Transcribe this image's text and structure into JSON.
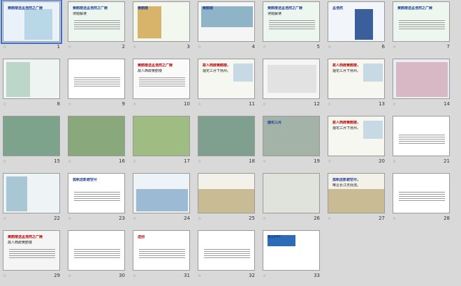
{
  "slides": [
    {
      "n": "1",
      "title": "黄鹤楼送孟浩然之广陵",
      "body": "",
      "bg": "#e8f2f8"
    },
    {
      "n": "2",
      "title": "黄鹤楼送孟浩然之广陵",
      "body": "诗题解读",
      "bg": "#eef7ef"
    },
    {
      "n": "3",
      "title": "黄鹤楼",
      "body": "",
      "bg": "#f3f8ee"
    },
    {
      "n": "4",
      "title": "黄鹤楼",
      "body": "",
      "bg": "#f5f5f5"
    },
    {
      "n": "5",
      "title": "黄鹤楼送孟浩然之广陵",
      "body": "诗题解读",
      "bg": "#eef7ef"
    },
    {
      "n": "6",
      "title": "孟浩然",
      "body": "",
      "bg": "#f2f6fb"
    },
    {
      "n": "7",
      "title": "黄鹤楼送孟浩然之广陵",
      "body": "",
      "bg": "#eef7ef"
    },
    {
      "n": "8",
      "title": "",
      "body": "",
      "bg": "#eef4f1"
    },
    {
      "n": "9",
      "title": "",
      "body": "",
      "bg": "#ffffff"
    },
    {
      "n": "10",
      "title": "黄鹤楼送孟浩然之广陵",
      "body": "故人西辞黄鹤楼",
      "bg": "#fafafa"
    },
    {
      "n": "11",
      "title": "故人西辞黄鹤楼，",
      "body": "烟花三月下扬州。",
      "bg": "#f7f7f2"
    },
    {
      "n": "12",
      "title": "",
      "body": "",
      "bg": "#f5f5f5"
    },
    {
      "n": "13",
      "title": "故人西辞黄鹤楼，",
      "body": "烟花三月下扬州。",
      "bg": "#f7f7f2"
    },
    {
      "n": "14",
      "title": "",
      "body": "",
      "bg": "#e9eef3"
    },
    {
      "n": "15",
      "title": "",
      "body": "",
      "bg": "#dfe8df"
    },
    {
      "n": "16",
      "title": "",
      "body": "",
      "bg": "#dde6d8"
    },
    {
      "n": "17",
      "title": "",
      "body": "",
      "bg": "#e7efe0"
    },
    {
      "n": "18",
      "title": "",
      "body": "",
      "bg": "#e3ece4"
    },
    {
      "n": "19",
      "title": "烟花三月",
      "body": "",
      "bg": "#cfd8cf"
    },
    {
      "n": "20",
      "title": "故人西辞黄鹤楼，",
      "body": "烟花三月下扬州。",
      "bg": "#f7f7f2"
    },
    {
      "n": "21",
      "title": "",
      "body": "",
      "bg": "#ffffff"
    },
    {
      "n": "22",
      "title": "",
      "body": "",
      "bg": "#eef4f6"
    },
    {
      "n": "23",
      "title": "孤帆远影碧空尽",
      "body": "",
      "bg": "#ffffff"
    },
    {
      "n": "24",
      "title": "",
      "body": "",
      "bg": "#eef3f8"
    },
    {
      "n": "25",
      "title": "",
      "body": "",
      "bg": "#f3f1ea"
    },
    {
      "n": "26",
      "title": "",
      "body": "",
      "bg": "#eceee9"
    },
    {
      "n": "27",
      "title": "孤帆远影碧空尽，",
      "body": "唯见长江天际流。",
      "bg": "#f3f1ea"
    },
    {
      "n": "28",
      "title": "",
      "body": "",
      "bg": "#ffffff"
    },
    {
      "n": "29",
      "title": "黄鹤楼送孟浩然之广陵",
      "body": "故人西辞黄鹤楼",
      "bg": "#f5f5f5"
    },
    {
      "n": "30",
      "title": "",
      "body": "",
      "bg": "#ffffff"
    },
    {
      "n": "31",
      "title": "送别",
      "body": "",
      "bg": "#ffffff"
    },
    {
      "n": "32",
      "title": "",
      "body": "",
      "bg": "#ffffff"
    },
    {
      "n": "33",
      "title": "第1PPT",
      "body": "",
      "bg": "#ffffff"
    }
  ]
}
